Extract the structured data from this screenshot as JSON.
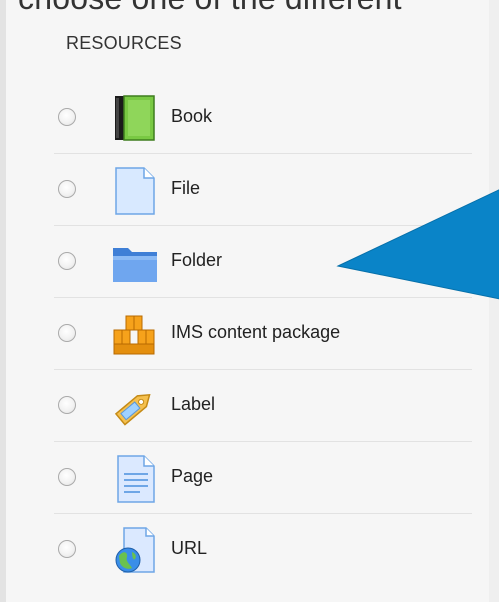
{
  "top_text": "choose one of the different",
  "section_title": "RESOURCES",
  "resources": [
    {
      "label": "Book",
      "icon": "book-icon"
    },
    {
      "label": "File",
      "icon": "file-icon"
    },
    {
      "label": "Folder",
      "icon": "folder-icon"
    },
    {
      "label": "IMS content package",
      "icon": "ims-package-icon"
    },
    {
      "label": "Label",
      "icon": "label-tag-icon"
    },
    {
      "label": "Page",
      "icon": "page-icon"
    },
    {
      "label": "URL",
      "icon": "url-globe-icon"
    }
  ],
  "colors": {
    "pointer": "#0a84c8",
    "book_green": "#79c943",
    "folder_blue": "#5b93e6"
  }
}
